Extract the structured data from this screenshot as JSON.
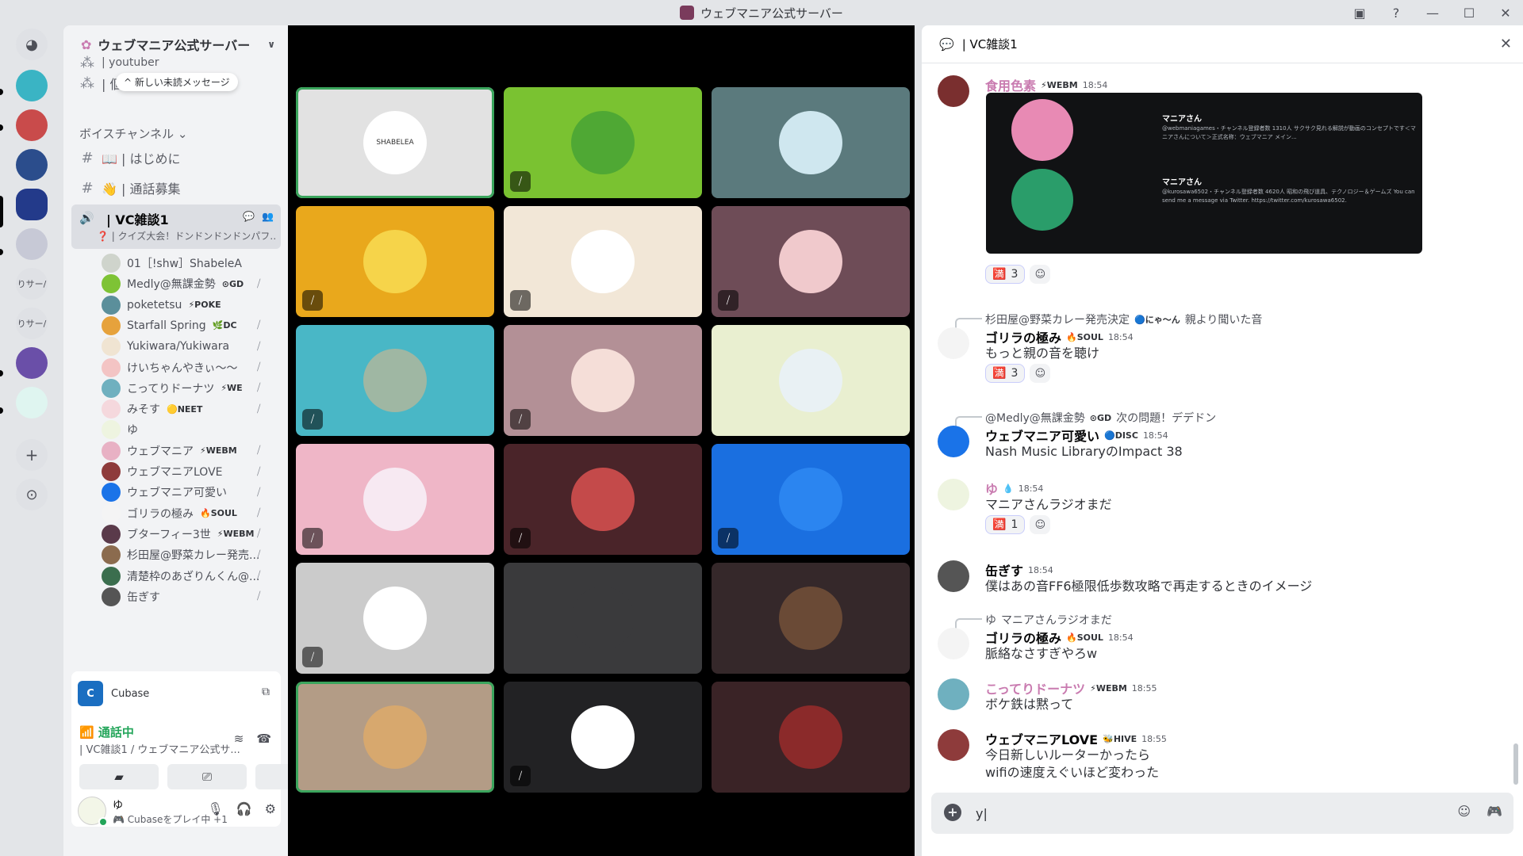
{
  "window": {
    "title": "ウェブマニア公式サーバー",
    "controls": [
      "▣",
      "?",
      "—",
      "☐",
      "✕"
    ]
  },
  "servers": [
    {
      "label": "◕",
      "color": "#5865f2"
    },
    {
      "label": "",
      "color": "#3ab4c4"
    },
    {
      "label": "",
      "color": "#c94b4b"
    },
    {
      "label": "",
      "color": "#2b4d8c"
    },
    {
      "label": "",
      "color": "#233a8a"
    },
    {
      "label": "",
      "color": "#c7c9d6"
    },
    {
      "label": "りサー/",
      "color": "#dfe1e5"
    },
    {
      "label": "りサー/",
      "color": "#dfe1e5"
    },
    {
      "label": "",
      "color": "#6a4fa8"
    },
    {
      "label": "",
      "color": "#dff5f0"
    },
    {
      "label": "+",
      "color": "#dfe1e5"
    },
    {
      "label": "⊙",
      "color": "#dfe1e5"
    }
  ],
  "sidebar": {
    "server_name": "ウェブマニア公式サーバー",
    "new_unread": "^ 新しい未読メッセージ",
    "top_channels": [
      {
        "name": "| youtuber"
      },
      {
        "name": "| 個人開発勢"
      }
    ],
    "voice_category": "ボイスチャンネル",
    "text_channels": [
      {
        "name": "📖 | はじめに"
      },
      {
        "name": "👋 | 通話募集"
      }
    ],
    "active_vc": {
      "name": "| VC雑談1",
      "status": "❓ | クイズ大会！ドンドンドンドンパフ…"
    },
    "members": [
      {
        "name": "01［!shw］ShabeleA",
        "tag": "",
        "color": "#cfd4cc"
      },
      {
        "name": "Medly@無課金勢",
        "tag": "⊙GD",
        "color": "#7ec335"
      },
      {
        "name": "poketetsu",
        "tag": "⚡POKE",
        "color": "#5b8f9b"
      },
      {
        "name": "Starfall Spring",
        "tag": "🌿DC",
        "color": "#e6a23c"
      },
      {
        "name": "Yukiwara/Yukiwara",
        "tag": "",
        "color": "#f0e4d2"
      },
      {
        "name": "けいちゃんやきぃ～～",
        "tag": "",
        "color": "#f3c4c4"
      },
      {
        "name": "こってりドーナツ",
        "tag": "⚡WE",
        "color": "#6fb0bf"
      },
      {
        "name": "みそす",
        "tag": "🟡NEET",
        "color": "#f5d8dd"
      },
      {
        "name": "ゆ",
        "tag": "",
        "color": "#eef4e0"
      },
      {
        "name": "ウェブマニア",
        "tag": "⚡WEBM",
        "color": "#e8b1c4"
      },
      {
        "name": "ウェブマニアLOVE",
        "tag": "",
        "color": "#8e3b3b"
      },
      {
        "name": "ウェブマニア可愛い",
        "tag": "",
        "color": "#1a73e8"
      },
      {
        "name": "ゴリラの極み",
        "tag": "🔥SOUL",
        "color": "#f4f4f4"
      },
      {
        "name": "ブターフィー3世",
        "tag": "⚡WEBM",
        "color": "#5a3a4a"
      },
      {
        "name": "杉田屋@野菜カレー発売...",
        "tag": "",
        "color": "#8b6b4e"
      },
      {
        "name": "清楚枠のあざりんくん@...",
        "tag": "",
        "color": "#3b6e4e"
      },
      {
        "name": "缶ぎす",
        "tag": "",
        "color": "#555"
      }
    ]
  },
  "userpanel": {
    "app": "Cubase",
    "connection": "通話中",
    "channel": "| VC雑談1 / ウェブマニア公式サ...",
    "username": "ゆ",
    "activity": "🎮 Cubaseをプレイ中 +1"
  },
  "tiles": [
    {
      "bg": "#e2e2e2",
      "av": "#ffffff",
      "label": "SHABELEA",
      "muted": false,
      "speaking": true
    },
    {
      "bg": "#7ac231",
      "av": "#4fa834",
      "label": "",
      "muted": true,
      "speaking": false
    },
    {
      "bg": "#5b7a7d",
      "av": "#cfe7ef",
      "label": "",
      "muted": false,
      "speaking": false
    },
    {
      "bg": "#e9a81c",
      "av": "#f6d44a",
      "label": "",
      "muted": true,
      "speaking": false
    },
    {
      "bg": "#f2e7d7",
      "av": "#ffffff",
      "label": "",
      "muted": true,
      "speaking": false
    },
    {
      "bg": "#6e4c57",
      "av": "#f0c9cc",
      "label": "",
      "muted": true,
      "speaking": false
    },
    {
      "bg": "#49b7c6",
      "av": "#9fb7a3",
      "label": "",
      "muted": true,
      "speaking": false
    },
    {
      "bg": "#b39096",
      "av": "#f5ded8",
      "label": "",
      "muted": true,
      "speaking": false
    },
    {
      "bg": "#e9efd0",
      "av": "#e9f1f4",
      "label": "",
      "muted": false,
      "speaking": false
    },
    {
      "bg": "#efb6c7",
      "av": "#f7e9f2",
      "label": "",
      "muted": true,
      "speaking": false
    },
    {
      "bg": "#4a2429",
      "av": "#c44a4a",
      "label": "",
      "muted": true,
      "speaking": false
    },
    {
      "bg": "#1a6fe0",
      "av": "#2b85f0",
      "label": "",
      "muted": true,
      "speaking": false
    },
    {
      "bg": "#cbcbcb",
      "av": "#ffffff",
      "label": "",
      "muted": true,
      "speaking": false
    },
    {
      "bg": "#3a3a3c",
      "av": "#3a3a3c",
      "label": "",
      "muted": false,
      "speaking": false
    },
    {
      "bg": "#35282a",
      "av": "#6a4a36",
      "label": "",
      "muted": false,
      "speaking": false
    },
    {
      "bg": "#b39c86",
      "av": "#d7a86e",
      "label": "",
      "muted": false,
      "speaking": true
    },
    {
      "bg": "#222224",
      "av": "#ffffff",
      "label": "",
      "muted": true,
      "speaking": false
    },
    {
      "bg": "#3a2326",
      "av": "#8b2a2a",
      "label": "",
      "muted": false,
      "speaking": false
    }
  ],
  "chat": {
    "channel": "| VC雑談1",
    "messages": [
      {
        "author": "食用色素",
        "author_color": "#c97bb0",
        "badge": "⚡WEBM",
        "time": "18:54",
        "avatar": "#7a2f2f",
        "body": ""
      },
      {
        "reply_to": "杉田屋@野菜カレー発売決定",
        "reply_badge": "🔵にゃ～ん",
        "reply_text": "親より聞いた音",
        "author": "ゴリラの極み",
        "author_color": "#060607",
        "badge": "🔥SOUL",
        "time": "18:54",
        "avatar": "#f4f4f4",
        "body": "もっと親の音を聴け"
      },
      {
        "reply_to": "@Medly@無課金勢",
        "reply_badge": "⊙GD",
        "reply_text": "次の問題！デデドン",
        "author": "ウェブマニア可愛い",
        "author_color": "#060607",
        "badge": "🔵DISC",
        "time": "18:54",
        "avatar": "#1a73e8",
        "body": "Nash Music LibraryのImpact 38"
      },
      {
        "author": "ゆ",
        "author_color": "#c97bb0",
        "badge": "💧",
        "time": "18:54",
        "avatar": "#eef4e0",
        "body": "マニアさんラジオまだ"
      },
      {
        "author": "缶ぎす",
        "author_color": "#060607",
        "badge": "",
        "time": "18:54",
        "avatar": "#555",
        "body": "僕はあの音FF6極限低歩数攻略で再走するときのイメージ"
      },
      {
        "reply_to": "ゆ",
        "reply_badge": "",
        "reply_text": "マニアさんラジオまだ",
        "author": "ゴリラの極み",
        "author_color": "#060607",
        "badge": "🔥SOUL",
        "time": "18:54",
        "avatar": "#f4f4f4",
        "body": "脈絡なさすぎやろw"
      },
      {
        "author": "こってりドーナツ",
        "author_color": "#c97bb0",
        "badge": "⚡WEBM",
        "time": "18:55",
        "avatar": "#6fb0bf",
        "body": "ボケ鉄は黙って"
      },
      {
        "author": "ウェブマニアLOVE",
        "author_color": "#060607",
        "badge": "🐝HIVE",
        "time": "18:55",
        "avatar": "#8e3b3b",
        "body": "今日新しいルーターかったら",
        "body2": "wifiの速度えぐいほど変わった"
      }
    ],
    "reactions": [
      {
        "emoji": "🈵",
        "count": "3"
      },
      {
        "emoji": "🈵",
        "count": "3"
      },
      {
        "emoji": "🈵",
        "count": "1"
      }
    ],
    "embed": [
      {
        "title": "マニアさん",
        "desc": "@webmaniagames・チャンネル登録者数 1310人 サクサク見れる解説が動画のコンセプトです＜マニアさんについて＞正式名称：ウェブマニア メイン..."
      },
      {
        "title": "マニアさん",
        "desc": "@kurosawa6502・チャンネル登録者数 4620人 昭和の飛び道具、テクノロジー＆ゲームズ You can send me a message via Twitter. https://twitter.com/kurosawa6502."
      }
    ],
    "input_value": "y|"
  }
}
